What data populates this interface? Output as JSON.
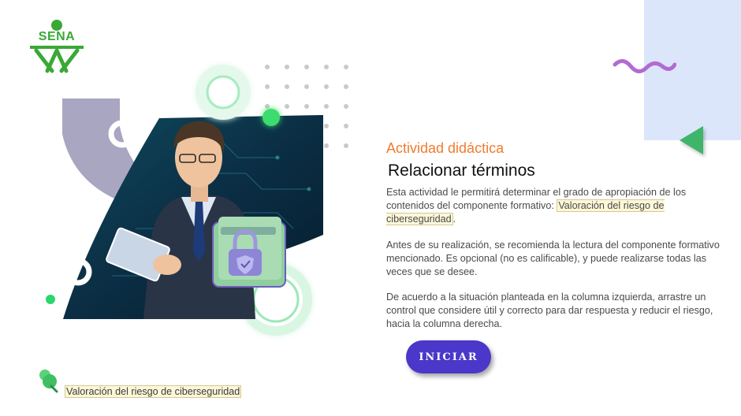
{
  "brand": {
    "logo_text": "SENA",
    "color": "#39a935"
  },
  "activity": {
    "eyebrow": "Actividad didáctica",
    "title": "Relacionar términos",
    "paragraph1": {
      "before": "Esta actividad le permitirá determinar el grado de apropiación de los contenidos del componente formativo: ",
      "highlight": "Valoración del riesgo de ciberseguridad",
      "after": "."
    },
    "paragraph2": "Antes de su realización, se recomienda la lectura del componente formativo mencionado.  Es opcional (no es calificable), y puede realizarse todas las veces que se desee.",
    "paragraph3": "De acuerdo a la situación planteada en la columna izquierda, arrastre un control que considere útil y correcto para dar respuesta y reducir el riesgo, hacia la columna derecha.",
    "start_button": "INICIAR"
  },
  "footer": {
    "component_name": "Valoración del riesgo de ciberseguridad"
  },
  "colors": {
    "accent_orange": "#f07b2e",
    "button_purple": "#4b37c9",
    "decor_green": "#3fb56a",
    "decor_blue": "#dce6fb",
    "squiggle_purple": "#b26bd1",
    "highlight_bg": "#fcf7d9"
  },
  "icons": [
    "sena-logo-icon",
    "squiggle-decoration-icon",
    "triangle-decoration-icon",
    "padlock-folder-icon",
    "pin-icon"
  ]
}
